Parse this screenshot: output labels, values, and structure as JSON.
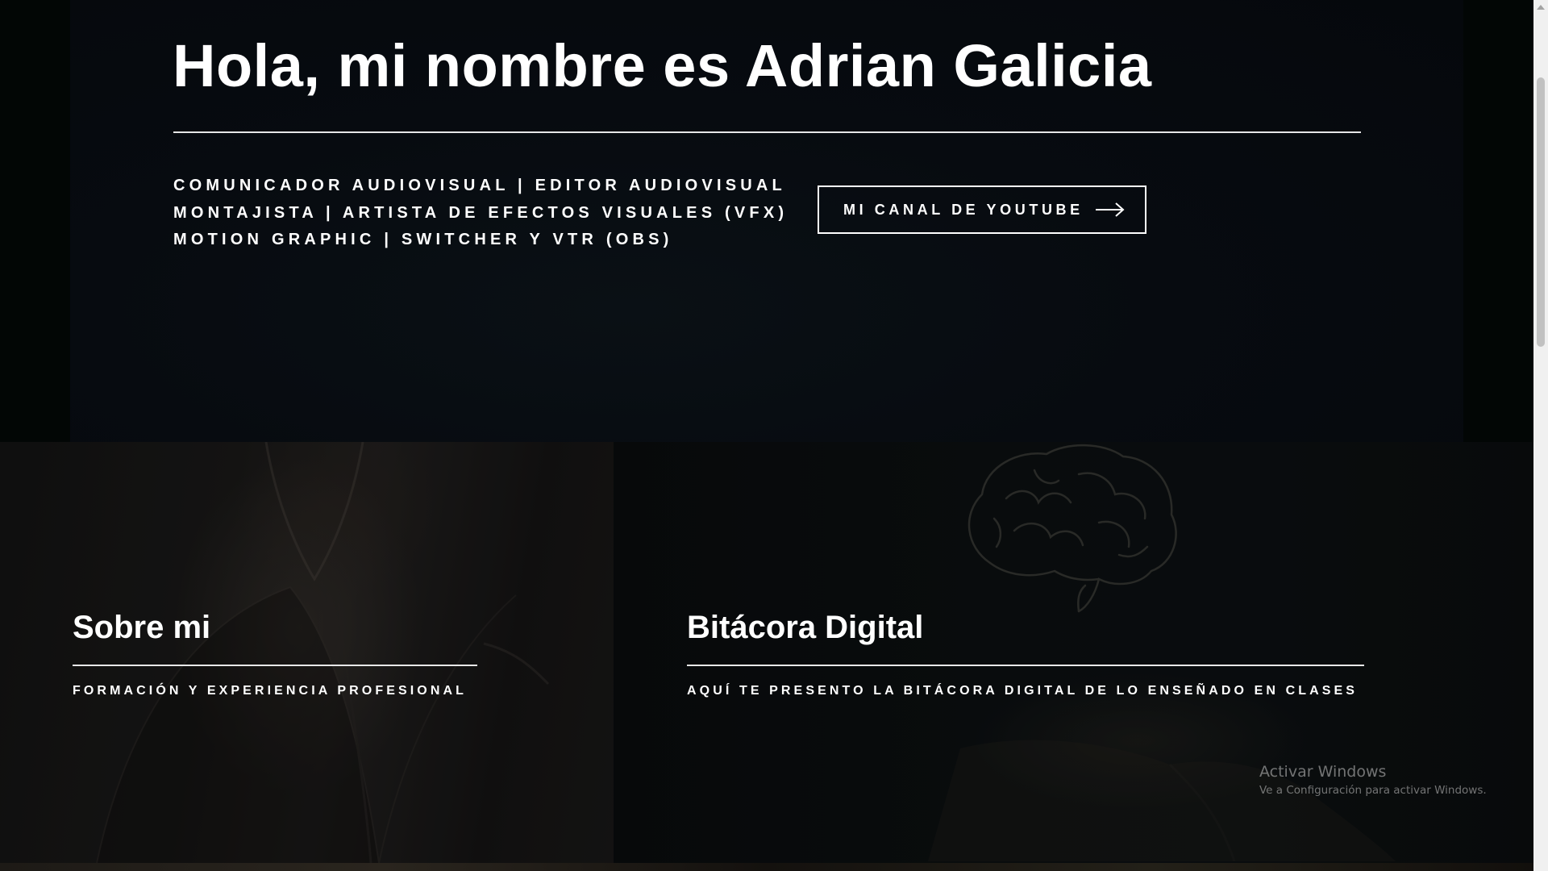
{
  "hero": {
    "title": "Hola, mi nombre es Adrian Galicia",
    "roles": [
      "COMUNICADOR AUDIOVISUAL | EDITOR AUDIOVISUAL",
      "MONTAJISTA | ARTISTA DE EFECTOS VISUALES (VFX)",
      "MOTION GRAPHIC | SWITCHER Y VTR (OBS)"
    ],
    "cta_label": "MI CANAL DE YOUTUBE",
    "cta_icon": "arrow-right-icon"
  },
  "cards": {
    "about": {
      "title": "Sobre mi",
      "subtitle": "FORMACIÓN Y EXPERIENCIA PROFESIONAL"
    },
    "blog": {
      "title": "Bitácora Digital",
      "subtitle": "AQUÍ TE PRESENTO LA BITÁCORA DIGITAL DE LO ENSEÑADO EN CLASES",
      "icon": "brain-icon"
    }
  },
  "watermark": {
    "line1": "Activar Windows",
    "line2": "Ve a Configuración para activar Windows."
  },
  "colors": {
    "background": "#05080c",
    "text": "#ffffff",
    "scrollbar_track": "#f0f0f0",
    "scrollbar_thumb": "#c1c1c1"
  }
}
